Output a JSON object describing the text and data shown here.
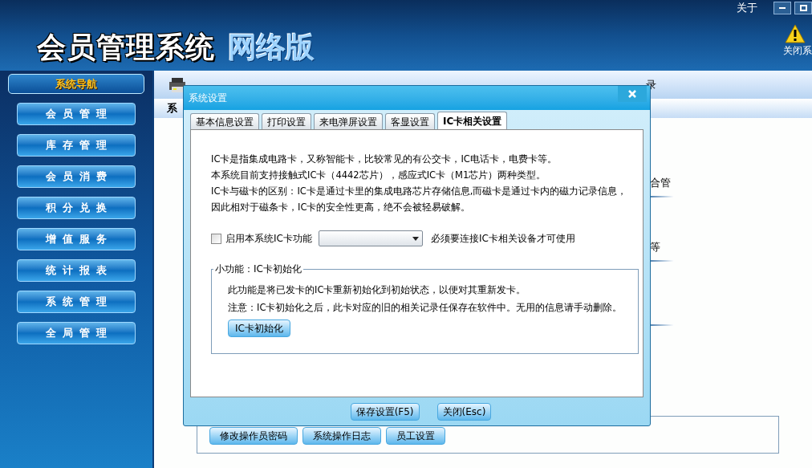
{
  "app": {
    "title": "会员管理系统",
    "edition": "网络版",
    "about": "关于",
    "close_system": "关闭系"
  },
  "sidebar": {
    "header": "系统导航",
    "items": [
      {
        "label": "会员管理"
      },
      {
        "label": "库存管理"
      },
      {
        "label": "会员消费"
      },
      {
        "label": "积分兑换"
      },
      {
        "label": "增值服务"
      },
      {
        "label": "统计报表"
      },
      {
        "label": "系统管理"
      },
      {
        "label": "全局管理"
      }
    ]
  },
  "toolbar": {
    "fragment": "录"
  },
  "content": {
    "heading_fragment": "系",
    "fragments": [
      "合管",
      "等"
    ],
    "buttons": [
      "修改操作员密码",
      "系统操作日志",
      "员工设置"
    ]
  },
  "dialog": {
    "title": "系统设置",
    "tabs": [
      {
        "label": "基本信息设置",
        "selected": false
      },
      {
        "label": "打印设置",
        "selected": false
      },
      {
        "label": "来电弹屏设置",
        "selected": false
      },
      {
        "label": "客显设置",
        "selected": false
      },
      {
        "label": "IC卡相关设置",
        "selected": true
      }
    ],
    "intro": [
      "IC卡是指集成电路卡，又称智能卡，比较常见的有公交卡，IC电话卡，电费卡等。",
      "本系统目前支持接触式IC卡（4442芯片），感应式IC卡（M1芯片）两种类型。",
      "IC卡与磁卡的区别：IC卡是通过卡里的集成电路芯片存储信息,而磁卡是通过卡内的磁力记录信息，",
      "因此相对于磁条卡，IC卡的安全性更高，绝不会被轻易破解。"
    ],
    "enable": {
      "label": "启用本系统IC卡功能",
      "checked": false
    },
    "hint": "必须要连接IC卡相关设备才可使用",
    "group": {
      "legend": "小功能：IC卡初始化",
      "lines": [
        "此功能是将已发卡的IC卡重新初始化到初始状态，以便对其重新发卡。",
        "注意：IC卡初始化之后，此卡对应的旧的相关记录任保存在软件中。无用的信息请手动删除。"
      ],
      "button": "IC卡初始化"
    },
    "buttons": [
      "保存设置(F5)",
      "关闭(Esc)"
    ]
  }
}
